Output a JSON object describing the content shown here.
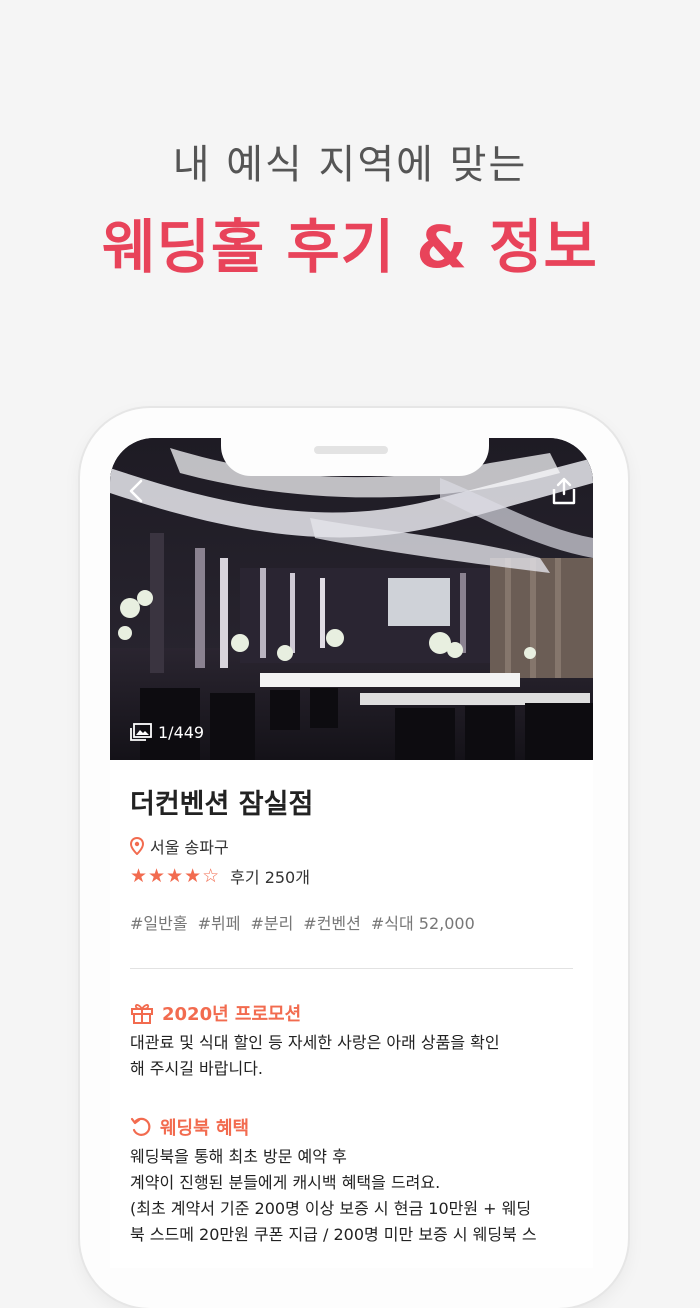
{
  "headline": {
    "line1": "내 예식 지역에 맞는",
    "line2": "웨딩홀 후기 & 정보"
  },
  "colors": {
    "accent": "#e8435a",
    "orange": "#f26b4f"
  },
  "header": {
    "back_icon": "chevron-left-icon",
    "share_icon": "share-icon"
  },
  "photo": {
    "count": "1/449",
    "icon": "image-gallery-icon"
  },
  "venue": {
    "name": "더컨벤션 잠실점",
    "location": "서울 송파구",
    "rating": 4,
    "rating_max": 5,
    "stars": "★★★★☆",
    "review_count": "후기 250개",
    "tags": [
      "#일반홀",
      "#뷔페",
      "#분리",
      "#컨벤션",
      "#식대 52,000"
    ]
  },
  "promotion": {
    "title": "2020년 프로모션",
    "icon": "gift-icon",
    "lines": [
      "대관료 및 식대 할인 등 자세한 사랑은 아래 상품을 확인",
      "해 주시길 바랍니다."
    ]
  },
  "benefit": {
    "title": "웨딩북 혜택",
    "icon": "refresh-icon",
    "lines": [
      "웨딩북을 통해 최초 방문 예약 후",
      "계약이 진행된 분들에게 캐시백 혜택을 드려요.",
      "(최초 계약서 기준 200명 이상 보증 시 현금 10만원 + 웨딩",
      "북 스드메 20만원 쿠폰 지급 / 200명 미만 보증 시 웨딩북 스"
    ]
  }
}
